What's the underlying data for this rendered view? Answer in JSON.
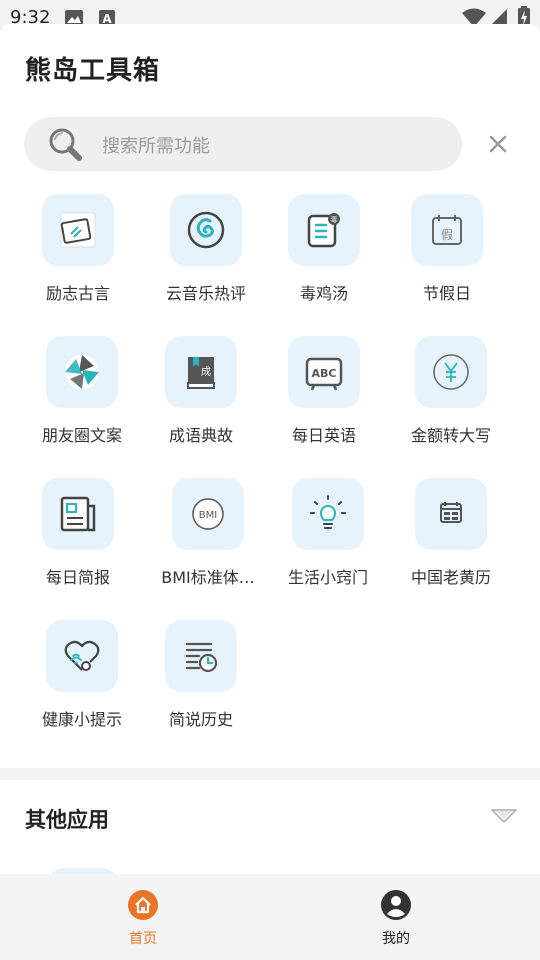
{
  "status_bar": {
    "time": "9:32"
  },
  "app": {
    "title": "熊岛工具箱"
  },
  "search": {
    "placeholder": "搜索所需功能"
  },
  "tools": [
    {
      "label": "励志古言",
      "icon": "card-icon"
    },
    {
      "label": "云音乐热评",
      "icon": "netease-music-icon"
    },
    {
      "label": "毒鸡汤",
      "icon": "document-badge-icon"
    },
    {
      "label": "节假日",
      "icon": "calendar-holiday-icon"
    },
    {
      "label": "朋友圈文案",
      "icon": "aperture-icon"
    },
    {
      "label": "成语典故",
      "icon": "idiom-book-icon"
    },
    {
      "label": "每日英语",
      "icon": "abc-board-icon"
    },
    {
      "label": "金额转大写",
      "icon": "yen-icon"
    },
    {
      "label": "每日简报",
      "icon": "newspaper-icon"
    },
    {
      "label": "BMI标准体…",
      "icon": "bmi-icon"
    },
    {
      "label": "生活小窍门",
      "icon": "lightbulb-icon"
    },
    {
      "label": "中国老黄历",
      "icon": "almanac-calendar-icon"
    },
    {
      "label": "健康小提示",
      "icon": "heart-stethoscope-icon"
    },
    {
      "label": "简说历史",
      "icon": "history-list-icon"
    }
  ],
  "other_apps": {
    "title": "其他应用"
  },
  "tabbar": {
    "home": {
      "label": "首页",
      "active": true
    },
    "mine": {
      "label": "我的",
      "active": false
    }
  },
  "colors": {
    "accent": "#e8742a",
    "icon_bg": "#e6f3fc",
    "icon_stroke": "#4a4a4a",
    "icon_teal": "#2bb3bd"
  }
}
